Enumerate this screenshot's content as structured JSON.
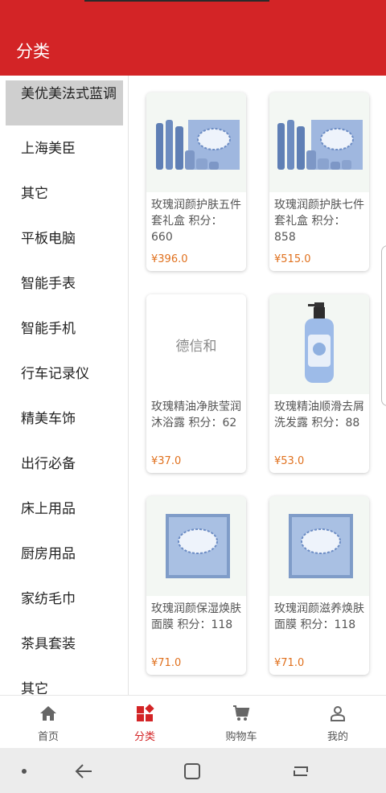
{
  "header": {
    "title": "分类"
  },
  "sidebar": {
    "selected": "美优美法式蓝调",
    "items": [
      "上海美臣",
      "其它",
      "平板电脑",
      "智能手表",
      "智能手机",
      "行车记录仪",
      "精美车饰",
      "出行必备",
      "床上用品",
      "厨房用品",
      "家纺毛巾",
      "茶具套装",
      "其它"
    ]
  },
  "products": [
    {
      "name": "玫瑰润颜护肤五件套礼盒 积分：660",
      "price": "¥396.0",
      "image": "skincare-set-image"
    },
    {
      "name": "玫瑰润颜护肤七件套礼盒 积分：858",
      "price": "¥515.0",
      "image": "skincare-set-image"
    },
    {
      "name": "玫瑰精油净肤莹润沐浴露 积分：62",
      "price": "¥37.0",
      "image_text": "德信和"
    },
    {
      "name": "玫瑰精油顺滑去屑洗发露 积分：88",
      "price": "¥53.0",
      "image": "shampoo-bottle-image"
    },
    {
      "name": "玫瑰润颜保湿焕肤面膜 积分：118",
      "price": "¥71.0",
      "image": "face-mask-box-image"
    },
    {
      "name": "玫瑰润颜滋养焕肤面膜 积分：118",
      "price": "¥71.0",
      "image": "face-mask-box-image"
    }
  ],
  "tabs": [
    {
      "label": "首页",
      "icon": "home-icon"
    },
    {
      "label": "分类",
      "icon": "category-icon"
    },
    {
      "label": "购物车",
      "icon": "cart-icon"
    },
    {
      "label": "我的",
      "icon": "profile-icon"
    }
  ],
  "colors": {
    "brand": "#d32426",
    "price": "#e0701d",
    "selected_bg": "#cfcfcf"
  }
}
